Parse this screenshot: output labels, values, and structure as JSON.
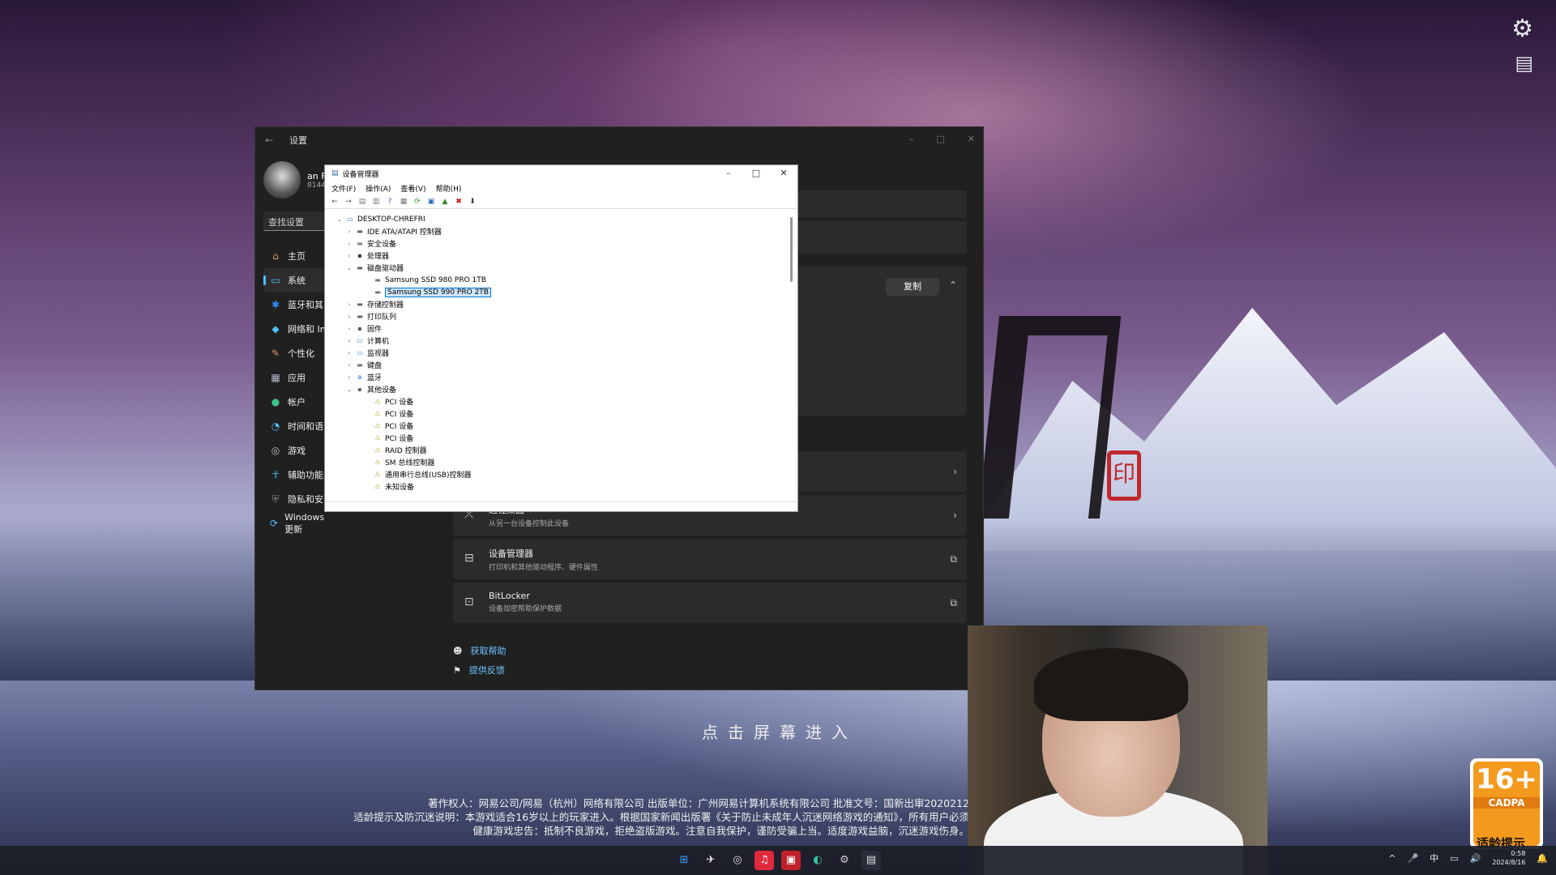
{
  "settings": {
    "title": "设置",
    "back": "←",
    "controls": [
      "–",
      "□",
      "✕"
    ],
    "profile_name": "an F",
    "profile_sub": "8144",
    "search_placeholder": "查找设置",
    "nav": [
      {
        "icon": "⌂",
        "label": "主页",
        "color": "#e3a05a"
      },
      {
        "icon": "▭",
        "label": "系统",
        "color": "#4cc2ff"
      },
      {
        "icon": "✱",
        "label": "蓝牙和其",
        "color": "#2f8fff"
      },
      {
        "icon": "◆",
        "label": "网络和 In",
        "color": "#4cc2ff"
      },
      {
        "icon": "✎",
        "label": "个性化",
        "color": "#e8925c"
      },
      {
        "icon": "▦",
        "label": "应用",
        "color": "#b0b8c8"
      },
      {
        "icon": "●",
        "label": "帐户",
        "color": "#3ec28a"
      },
      {
        "icon": "◔",
        "label": "时间和语",
        "color": "#4cc2ff"
      },
      {
        "icon": "◎",
        "label": "游戏",
        "color": "#bbb"
      },
      {
        "icon": "☥",
        "label": "辅助功能",
        "color": "#4cc2ff"
      },
      {
        "icon": "⛨",
        "label": "隐私和安",
        "color": "#888"
      },
      {
        "icon": "⟳",
        "label": "Windows 更新",
        "color": "#4cc2ff"
      }
    ],
    "copy_label": "复制",
    "cards": [
      {
        "icon": "⤫",
        "title": "远程桌面",
        "sub": "从另一台设备控制此设备"
      },
      {
        "icon": "⊟",
        "title": "设备管理器",
        "sub": "打印机和其他驱动程序、硬件属性"
      },
      {
        "icon": "⊡",
        "title": "BitLocker",
        "sub": "设备加密帮助保护数据"
      }
    ],
    "links": [
      {
        "icon": "☻",
        "label": "获取帮助"
      },
      {
        "icon": "⚑",
        "label": "提供反馈"
      }
    ]
  },
  "device_manager": {
    "title": "设备管理器",
    "controls": [
      "–",
      "□",
      "✕"
    ],
    "menu": [
      "文件(F)",
      "操作(A)",
      "查看(V)",
      "帮助(H)"
    ],
    "toolbar": [
      {
        "icon": "←",
        "name": "back-icon",
        "color": "#555"
      },
      {
        "icon": "→",
        "name": "forward-icon",
        "color": "#555"
      },
      {
        "icon": "▤",
        "name": "view-icon",
        "color": "#777"
      },
      {
        "icon": "▥",
        "name": "properties-icon",
        "color": "#777"
      },
      {
        "icon": "?",
        "name": "help-icon",
        "color": "#2060c0"
      },
      {
        "icon": "▦",
        "name": "list-icon",
        "color": "#777"
      },
      {
        "icon": "⟳",
        "name": "scan-icon",
        "color": "#3a9a3a"
      },
      {
        "icon": "▣",
        "name": "monitor-icon",
        "color": "#2a6ab0"
      },
      {
        "icon": "▲",
        "name": "update-driver-icon",
        "color": "#2a8a2a"
      },
      {
        "icon": "✖",
        "name": "uninstall-icon",
        "color": "#d01010"
      },
      {
        "icon": "⬇",
        "name": "download-icon",
        "color": "#333"
      }
    ],
    "tree": [
      {
        "level": 0,
        "exp": "v",
        "icon": "▭",
        "color": "#3b6ea8",
        "label": "DESKTOP-CHREFRI"
      },
      {
        "level": 1,
        "exp": ">",
        "icon": "▬",
        "color": "#666",
        "label": "IDE ATA/ATAPI 控制器"
      },
      {
        "level": 1,
        "exp": ">",
        "icon": "▬",
        "color": "#888",
        "label": "安全设备"
      },
      {
        "level": 1,
        "exp": ">",
        "icon": "▪",
        "color": "#333",
        "label": "处理器"
      },
      {
        "level": 1,
        "exp": "v",
        "icon": "▬",
        "color": "#666",
        "label": "磁盘驱动器"
      },
      {
        "level": 2,
        "exp": "",
        "icon": "▬",
        "color": "#777",
        "label": "Samsung SSD 980 PRO 1TB"
      },
      {
        "level": 2,
        "exp": "",
        "icon": "▬",
        "color": "#777",
        "label": "Samsung SSD 990 PRO 2TB",
        "selected": true
      },
      {
        "level": 1,
        "exp": ">",
        "icon": "▬",
        "color": "#666",
        "label": "存储控制器"
      },
      {
        "level": 1,
        "exp": ">",
        "icon": "▬",
        "color": "#666",
        "label": "打印队列"
      },
      {
        "level": 1,
        "exp": ">",
        "icon": "▪",
        "color": "#555",
        "label": "固件"
      },
      {
        "level": 1,
        "exp": ">",
        "icon": "▭",
        "color": "#3b8fd0",
        "label": "计算机"
      },
      {
        "level": 1,
        "exp": ">",
        "icon": "▭",
        "color": "#3b8fd0",
        "label": "监视器"
      },
      {
        "level": 1,
        "exp": ">",
        "icon": "▬",
        "color": "#777",
        "label": "键盘"
      },
      {
        "level": 1,
        "exp": ">",
        "icon": "ʙ",
        "color": "#1f6fd0",
        "label": "蓝牙"
      },
      {
        "level": 1,
        "exp": "v",
        "icon": "▪",
        "color": "#666",
        "label": "其他设备"
      },
      {
        "level": 2,
        "exp": "",
        "icon": "⚠",
        "color": "#c9a020",
        "label": "PCI 设备"
      },
      {
        "level": 2,
        "exp": "",
        "icon": "⚠",
        "color": "#c9a020",
        "label": "PCI 设备"
      },
      {
        "level": 2,
        "exp": "",
        "icon": "⚠",
        "color": "#c9a020",
        "label": "PCI 设备"
      },
      {
        "level": 2,
        "exp": "",
        "icon": "⚠",
        "color": "#c9a020",
        "label": "PCI 设备"
      },
      {
        "level": 2,
        "exp": "",
        "icon": "⚠",
        "color": "#c9a020",
        "label": "RAID 控制器"
      },
      {
        "level": 2,
        "exp": "",
        "icon": "⚠",
        "color": "#c9a020",
        "label": "SM 总线控制器"
      },
      {
        "level": 2,
        "exp": "",
        "icon": "⚠",
        "color": "#c9a020",
        "label": "通用串行总线(USB)控制器"
      },
      {
        "level": 2,
        "exp": "",
        "icon": "⚠",
        "color": "#c9a020",
        "label": "未知设备"
      }
    ]
  },
  "game": {
    "enter_text": "点击屏幕进入",
    "legal": [
      "著作权人：网易公司/网易（杭州）网络有限公司 出版单位：广州网易计算机系统有限公司 批准文号：国新出审2020212",
      "适龄提示及防沉迷说明：本游戏适合16岁以上的玩家进入。根据国家新闻出版署《关于防止未成年人沉迷网络游戏的通知》，所有用户必须",
      "健康游戏忠告：抵制不良游戏，拒绝盗版游戏。注意自我保护，谨防受骗上当。适度游戏益脑，沉迷游戏伤身。"
    ],
    "age_rating": "16+",
    "age_org": "CADPA",
    "age_tip": "适龄提示",
    "seal_char": "印",
    "corner_icons": [
      "gear-icon",
      "screen-icon"
    ]
  },
  "taskbar": {
    "apps": [
      {
        "name": "start",
        "icon": "⊞",
        "bg": "#1e1f2b",
        "color": "#3aa0ff"
      },
      {
        "name": "app-plane",
        "icon": "✈",
        "bg": "#1e1f2b",
        "color": "#eee"
      },
      {
        "name": "app-steam",
        "icon": "◎",
        "bg": "#1e1f2b",
        "color": "#ddd"
      },
      {
        "name": "app-netease-music",
        "icon": "♫",
        "bg": "#e02a3c",
        "color": "#fff"
      },
      {
        "name": "app-red",
        "icon": "▣",
        "bg": "#c0202a",
        "color": "#fff"
      },
      {
        "name": "app-edge",
        "icon": "◐",
        "bg": "#1e1f2b",
        "color": "#3ac0a0"
      },
      {
        "name": "app-settings",
        "icon": "⚙",
        "bg": "#1e1f2b",
        "color": "#ccc"
      },
      {
        "name": "app-device-manager",
        "icon": "▤",
        "bg": "#2a2c3a",
        "color": "#ddd"
      }
    ],
    "tray": [
      "^",
      "🎤",
      "中",
      "▭",
      "🔊"
    ],
    "time": "0:58",
    "date": "2024/8/16",
    "bell": "🔔"
  }
}
